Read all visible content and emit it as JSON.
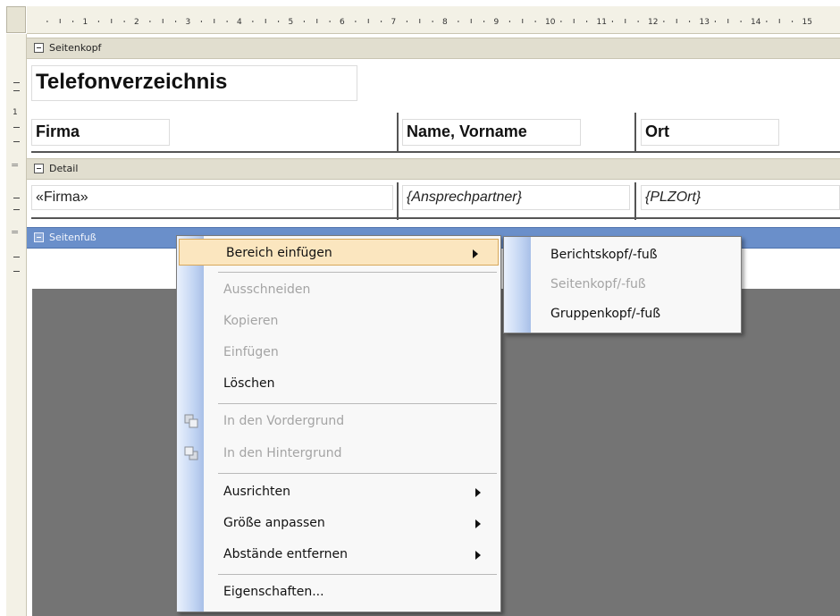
{
  "ruler": {
    "numbers": [
      "1",
      "2",
      "3",
      "4",
      "5",
      "6",
      "7",
      "8",
      "9",
      "10",
      "11",
      "12",
      "13",
      "14",
      "15"
    ],
    "vertical_number": "1"
  },
  "sections": {
    "page_header": "Seitenkopf",
    "detail": "Detail",
    "page_footer": "Seitenfuß"
  },
  "report": {
    "title": "Telefonverzeichnis",
    "columns": [
      "Firma",
      "Name, Vorname",
      "Ort"
    ],
    "detail_fields": [
      "«Firma»",
      "{Ansprechpartner}",
      "{PLZOrt}"
    ]
  },
  "context_menu": {
    "items": [
      {
        "label": "Bereich einfügen",
        "enabled": true,
        "submenu": true,
        "highlighted": true
      },
      {
        "label": "Ausschneiden",
        "enabled": false
      },
      {
        "label": "Kopieren",
        "enabled": false
      },
      {
        "label": "Einfügen",
        "enabled": false
      },
      {
        "label": "Löschen",
        "enabled": true
      },
      {
        "label": "In den Vordergrund",
        "enabled": false,
        "icon": "bring-to-front-icon"
      },
      {
        "label": "In den Hintergrund",
        "enabled": false,
        "icon": "send-to-back-icon"
      },
      {
        "label": "Ausrichten",
        "enabled": true,
        "submenu": true
      },
      {
        "label": "Größe anpassen",
        "enabled": true,
        "submenu": true
      },
      {
        "label": "Abstände entfernen",
        "enabled": true,
        "submenu": true
      },
      {
        "label": "Eigenschaften...",
        "enabled": true
      }
    ]
  },
  "submenu": {
    "items": [
      {
        "label": "Berichtskopf/-fuß",
        "enabled": true
      },
      {
        "label": "Seitenkopf/-fuß",
        "enabled": false
      },
      {
        "label": "Gruppenkopf/-fuß",
        "enabled": true
      }
    ]
  },
  "colors": {
    "selected_section": "#6a8fca",
    "menu_highlight": "#fbe6bf",
    "section_bar": "#e1decf",
    "grey_area": "#747474"
  }
}
